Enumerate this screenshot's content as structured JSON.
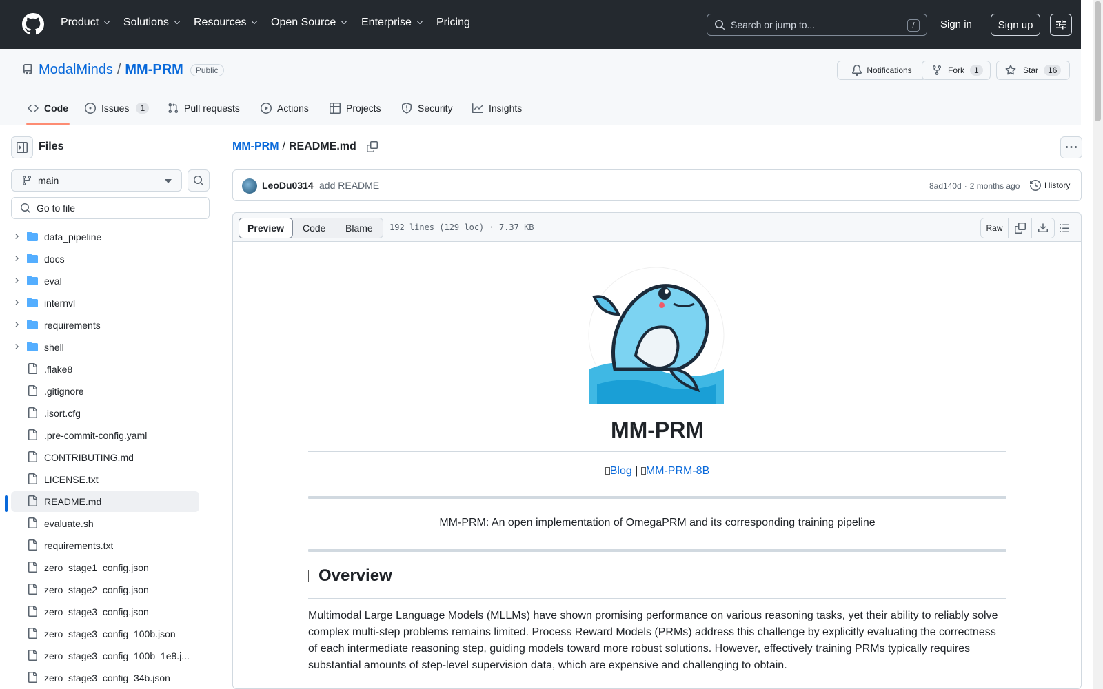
{
  "header": {
    "nav": [
      "Product",
      "Solutions",
      "Resources",
      "Open Source",
      "Enterprise"
    ],
    "pricing": "Pricing",
    "search_placeholder": "Search or jump to...",
    "search_shortcut": "/",
    "sign_in": "Sign in",
    "sign_up": "Sign up"
  },
  "repo": {
    "owner": "ModalMinds",
    "sep": "/",
    "name": "MM-PRM",
    "visibility": "Public",
    "notifications": "Notifications",
    "fork_label": "Fork",
    "fork_count": "1",
    "star_label": "Star",
    "star_count": "16"
  },
  "tabs": {
    "code": "Code",
    "issues": "Issues",
    "issues_count": "1",
    "pulls": "Pull requests",
    "actions": "Actions",
    "projects": "Projects",
    "security": "Security",
    "insights": "Insights"
  },
  "sidebar": {
    "title": "Files",
    "branch": "main",
    "goto_placeholder": "Go to file",
    "folders": [
      "data_pipeline",
      "docs",
      "eval",
      "internvl",
      "requirements",
      "shell"
    ],
    "files": [
      ".flake8",
      ".gitignore",
      ".isort.cfg",
      ".pre-commit-config.yaml",
      "CONTRIBUTING.md",
      "LICENSE.txt",
      "README.md",
      "evaluate.sh",
      "requirements.txt",
      "zero_stage1_config.json",
      "zero_stage2_config.json",
      "zero_stage3_config.json",
      "zero_stage3_config_100b.json",
      "zero_stage3_config_100b_1e8.j...",
      "zero_stage3_config_34b.json"
    ],
    "selected": "README.md"
  },
  "file": {
    "breadcrumb_repo": "MM-PRM",
    "breadcrumb_sep": "/",
    "breadcrumb_file": "README.md",
    "commit_author": "LeoDu0314",
    "commit_message": "add README",
    "commit_sha": "8ad140d",
    "commit_dot": "·",
    "commit_time": "2 months ago",
    "history": "History",
    "view_preview": "Preview",
    "view_code": "Code",
    "view_blame": "Blame",
    "stats": "192 lines (129 loc) · 7.37 KB",
    "raw": "Raw"
  },
  "readme": {
    "title": "MM-PRM",
    "link_blog": "Blog",
    "link_sep": " | ",
    "link_model": "MM-PRM-8B",
    "tagline": "MM-PRM: An open implementation of OmegaPRM and its corresponding training pipeline",
    "overview_heading": "Overview",
    "overview_text": "Multimodal Large Language Models (MLLMs) have shown promising performance on various reasoning tasks, yet their ability to reliably solve complex multi-step problems remains limited. Process Reward Models (PRMs) address this challenge by explicitly evaluating the correctness of each intermediate reasoning step, guiding models toward more robust solutions. However, effectively training PRMs typically requires substantial amounts of step-level supervision data, which are expensive and challenging to obtain."
  },
  "colors": {
    "header_bg": "#24292f",
    "link": "#0969da",
    "tab_underline": "#fd8c73",
    "selected_marker": "#0969da"
  }
}
